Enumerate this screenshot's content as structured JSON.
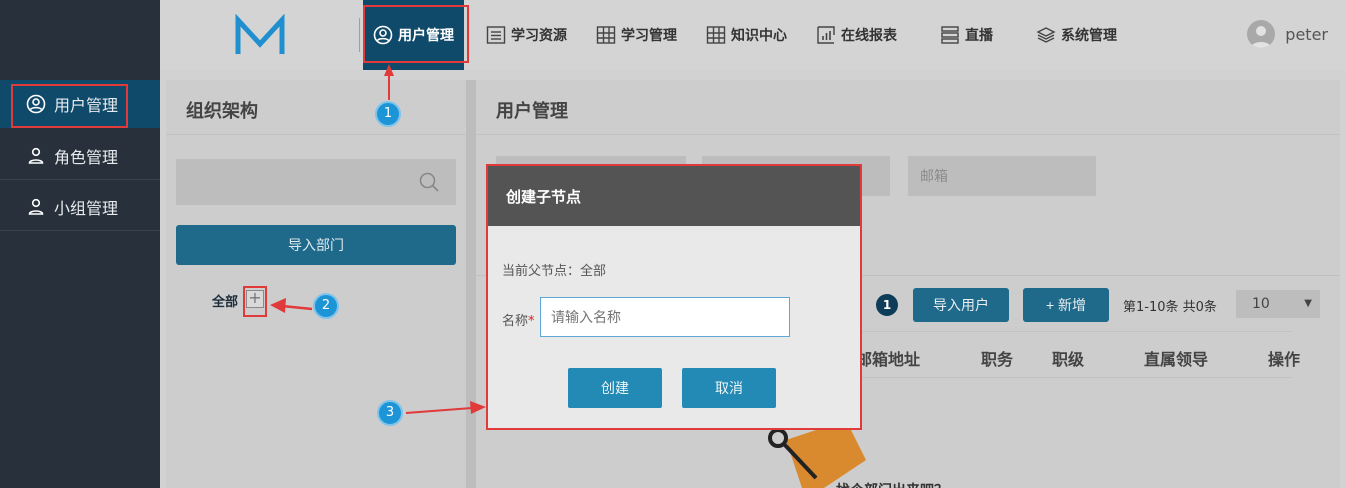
{
  "sidebar": {
    "items": [
      {
        "label": "用户管理",
        "icon": "user-circle-icon",
        "active": true
      },
      {
        "label": "角色管理",
        "icon": "person-icon",
        "active": false
      },
      {
        "label": "小组管理",
        "icon": "person-icon",
        "active": false
      }
    ]
  },
  "topnav": {
    "logo": "M",
    "items": [
      {
        "label": "用户管理",
        "icon": "user-circle-icon",
        "active": true
      },
      {
        "label": "学习资源",
        "icon": "list-doc-icon"
      },
      {
        "label": "学习管理",
        "icon": "grid-icon"
      },
      {
        "label": "知识中心",
        "icon": "grid-icon"
      },
      {
        "label": "在线报表",
        "icon": "chart-icon"
      },
      {
        "label": "直播",
        "icon": "server-icon"
      },
      {
        "label": "系统管理",
        "icon": "layers-icon"
      }
    ],
    "username": "peter"
  },
  "org_panel": {
    "title": "组织架构",
    "import_button": "导入部门",
    "tree_root": "全部",
    "tree_add_symbol": "+"
  },
  "user_panel": {
    "title": "用户管理",
    "email_placeholder": "邮箱",
    "badge_count": "1",
    "import_user_button": "导入用户",
    "add_button": "+ 新增",
    "pager_text": "第1-10条 共0条",
    "page_size": "10",
    "columns": [
      "邮箱地址",
      "职务",
      "职级",
      "直属领导",
      "操作"
    ],
    "empty_text": "找个部门出来吧？"
  },
  "modal": {
    "title": "创建子节点",
    "parent_label": "当前父节点：全部",
    "name_label": "名称",
    "required_mark": "*",
    "name_placeholder": "请输入名称",
    "create_button": "创建",
    "cancel_button": "取消"
  },
  "annotations": {
    "callouts": [
      "1",
      "2",
      "3"
    ],
    "color": "#e03a3a",
    "badge_color": "#1d94d6"
  }
}
